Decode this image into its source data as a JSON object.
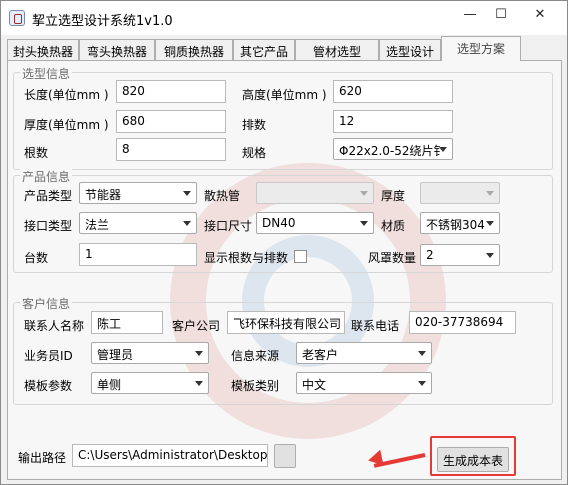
{
  "window": {
    "title": "挈立选型设计系统1v1.0"
  },
  "tabs": [
    "封头换热器",
    "弯头换热器",
    "铜质换热器",
    "其它产品",
    "管材选型",
    "选型设计",
    "选型方案"
  ],
  "selection": {
    "title": "选型信息",
    "length_label": "长度(单位mm )",
    "length_value": "820",
    "height_label": "高度(单位mm )",
    "height_value": "620",
    "thickness_label": "厚度(单位mm )",
    "thickness_value": "680",
    "rows_label": "排数",
    "rows_value": "12",
    "count_label": "根数",
    "count_value": "8",
    "spec_label": "规格",
    "spec_value": "Φ22x2.0-52绕片钅"
  },
  "product": {
    "title": "产品信息",
    "type_label": "产品类型",
    "type_value": "节能器",
    "radiator_label": "散热管",
    "radiator_value": "",
    "thickness_label": "厚度",
    "thickness_value": "",
    "interface_type_label": "接口类型",
    "interface_type_value": "法兰",
    "interface_size_label": "接口尺寸",
    "interface_size_value": "DN40",
    "material_label": "材质",
    "material_value": "不锈钢304",
    "units_label": "台数",
    "units_value": "1",
    "show_count_label": "显示根数与排数",
    "fan_label": "风罩数量",
    "fan_value": "2"
  },
  "customer": {
    "title": "客户信息",
    "contact_label": "联系人名称",
    "contact_value": "陈工",
    "company_label": "客户公司",
    "company_value": "飞环保科技有限公司",
    "phone_label": "联系电话",
    "phone_value": "020-37738694",
    "agent_label": "业务员ID",
    "agent_value": "管理员",
    "source_label": "信息来源",
    "source_value": "老客户",
    "template_param_label": "模板参数",
    "template_param_value": "单侧",
    "template_type_label": "模板类别",
    "template_type_value": "中文"
  },
  "output": {
    "path_label": "输出路径",
    "path_value": "C:\\Users\\Administrator\\Desktop",
    "generate_label": "生成成本表"
  },
  "colors": {
    "accent_red": "#e53935"
  }
}
